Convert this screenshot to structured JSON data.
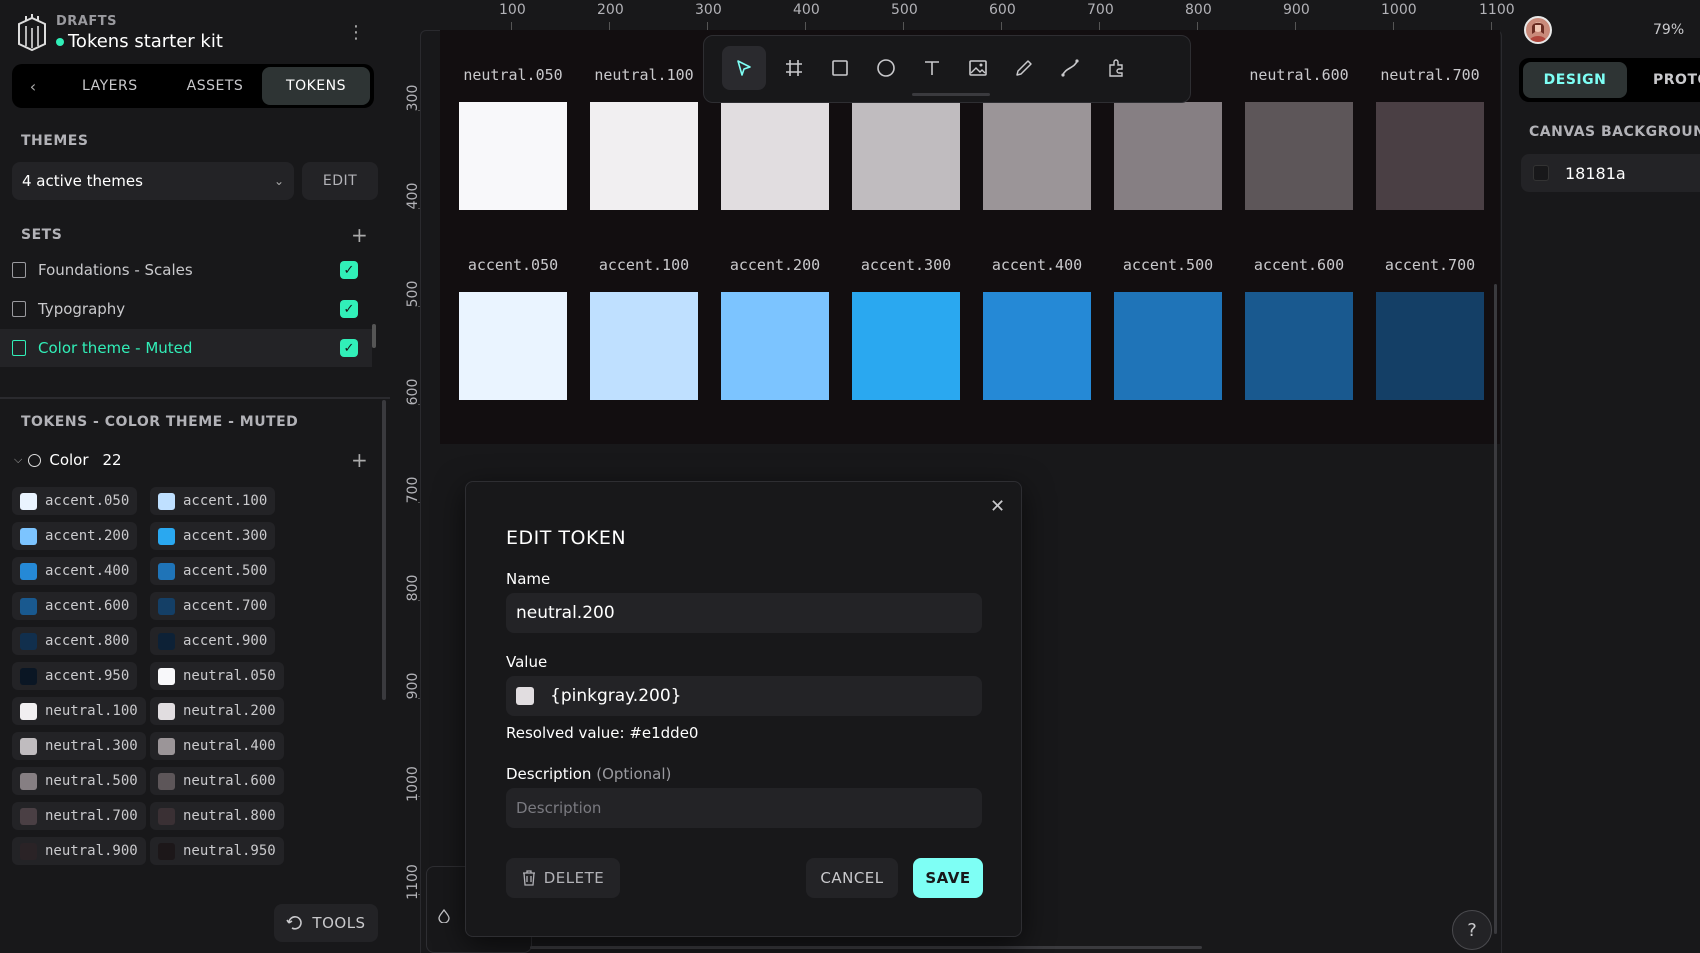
{
  "header": {
    "drafts_label": "DRAFTS",
    "project_name": "Tokens starter kit"
  },
  "sidebar": {
    "tabs": [
      {
        "label": "LAYERS"
      },
      {
        "label": "ASSETS"
      },
      {
        "label": "TOKENS"
      }
    ],
    "themes_label": "THEMES",
    "themes_value": "4 active themes",
    "edit_label": "EDIT",
    "sets_label": "SETS",
    "sets": [
      {
        "label": "Foundations - Scales"
      },
      {
        "label": "Typography"
      },
      {
        "label": "Color theme - Muted"
      }
    ],
    "tokens_label": "TOKENS - COLOR THEME - MUTED",
    "color_group": {
      "label": "Color",
      "count": "22"
    },
    "tokens": [
      {
        "label": "accent.050",
        "color": "#eaf4ff"
      },
      {
        "label": "accent.100",
        "color": "#bfe0ff"
      },
      {
        "label": "accent.200",
        "color": "#7cc4ff"
      },
      {
        "label": "accent.300",
        "color": "#2aa8f0"
      },
      {
        "label": "accent.400",
        "color": "#2589d6"
      },
      {
        "label": "accent.500",
        "color": "#1f74b8"
      },
      {
        "label": "accent.600",
        "color": "#19598f"
      },
      {
        "label": "accent.700",
        "color": "#143f66"
      },
      {
        "label": "accent.800",
        "color": "#112f4d"
      },
      {
        "label": "accent.900",
        "color": "#0d2136"
      },
      {
        "label": "accent.950",
        "color": "#0a1624"
      },
      {
        "label": "neutral.050",
        "color": "#f8f8fa"
      },
      {
        "label": "neutral.100",
        "color": "#f1eff1"
      },
      {
        "label": "neutral.200",
        "color": "#e1dde0"
      },
      {
        "label": "neutral.300",
        "color": "#c0bcbf"
      },
      {
        "label": "neutral.400",
        "color": "#9b9598"
      },
      {
        "label": "neutral.500",
        "color": "#867f83"
      },
      {
        "label": "neutral.600",
        "color": "#5d5659"
      },
      {
        "label": "neutral.700",
        "color": "#4a3f44"
      },
      {
        "label": "neutral.800",
        "color": "#3a3034"
      },
      {
        "label": "neutral.900",
        "color": "#2a2326"
      },
      {
        "label": "neutral.950",
        "color": "#1c1719"
      }
    ],
    "tools_label": "TOOLS"
  },
  "ruler": {
    "top": [
      "100",
      "200",
      "300",
      "400",
      "500",
      "600",
      "700",
      "800",
      "900",
      "1000",
      "1100"
    ],
    "left": [
      "300",
      "400",
      "500",
      "600",
      "700",
      "800",
      "900",
      "1000",
      "1100"
    ]
  },
  "canvas": {
    "neutral_row": [
      {
        "label": "neutral.050",
        "color": "#f8f8fa"
      },
      {
        "label": "neutral.100",
        "color": "#f1eff1"
      },
      {
        "label": "",
        "color": "#e1dde0"
      },
      {
        "label": "",
        "color": "#c0bcbf"
      },
      {
        "label": "",
        "color": "#9b9598"
      },
      {
        "label": ".500",
        "color": "#867f83"
      },
      {
        "label": "neutral.600",
        "color": "#5d5659"
      },
      {
        "label": "neutral.700",
        "color": "#4a3f44"
      }
    ],
    "accent_row": [
      {
        "label": "accent.050",
        "color": "#eaf4ff"
      },
      {
        "label": "accent.100",
        "color": "#bfe0ff"
      },
      {
        "label": "accent.200",
        "color": "#7cc4ff"
      },
      {
        "label": "accent.300",
        "color": "#2aa8f0"
      },
      {
        "label": "accent.400",
        "color": "#2589d6"
      },
      {
        "label": "accent.500",
        "color": "#1f74b8"
      },
      {
        "label": "accent.600",
        "color": "#19598f"
      },
      {
        "label": "accent.700",
        "color": "#143f66"
      }
    ]
  },
  "toolbar": {
    "tools": [
      "pointer-icon",
      "board-icon",
      "rectangle-icon",
      "ellipse-icon",
      "text-icon",
      "image-icon",
      "pencil-icon",
      "path-icon",
      "plugins-icon"
    ]
  },
  "modal": {
    "title": "EDIT TOKEN",
    "name_label": "Name",
    "name_value": "neutral.200",
    "value_label": "Value",
    "value_value": "{pinkgray.200}",
    "value_color": "#e1dde0",
    "resolved": "Resolved value: #e1dde0",
    "description_label": "Description",
    "description_optional": "(Optional)",
    "description_placeholder": "Description",
    "delete_label": "DELETE",
    "cancel_label": "CANCEL",
    "save_label": "SAVE"
  },
  "right_panel": {
    "zoom": "79%",
    "tabs": [
      {
        "label": "DESIGN"
      },
      {
        "label": "PROTO"
      }
    ],
    "canvas_bg_label": "CANVAS BACKGROUND",
    "canvas_bg_value": "18181a",
    "canvas_bg_color": "#18181a"
  },
  "colors": {
    "accent": "#31efb8",
    "save_button": "#7efff5"
  }
}
